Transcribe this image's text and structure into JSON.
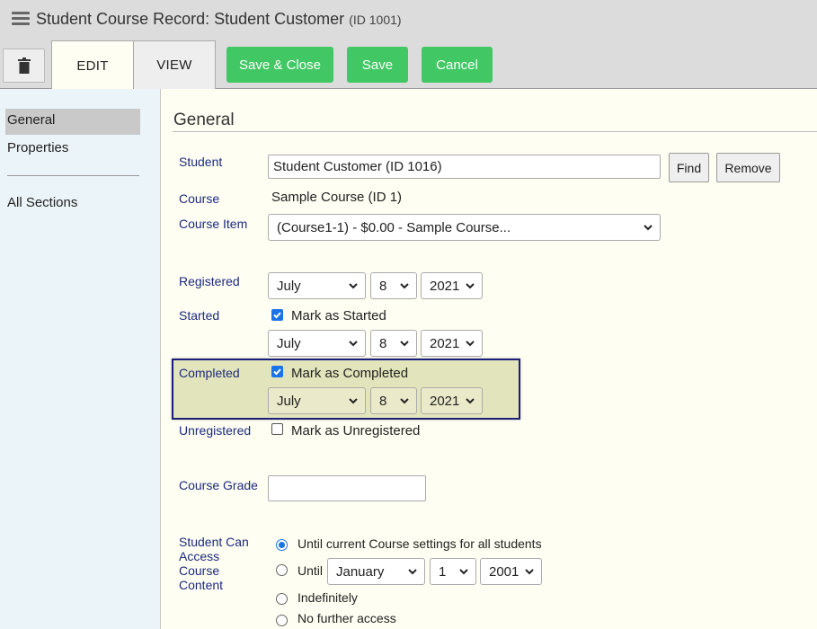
{
  "window": {
    "title": "Student Course Record: Student Customer",
    "title_id": "(ID 1001)"
  },
  "toolbar": {
    "tabs": [
      {
        "label": "EDIT"
      },
      {
        "label": "VIEW"
      }
    ],
    "save_close": "Save & Close",
    "save": "Save",
    "cancel": "Cancel"
  },
  "sidebar": {
    "items": [
      {
        "label": "General"
      },
      {
        "label": "Properties"
      },
      {
        "label": "All Sections"
      }
    ]
  },
  "section": {
    "title": "General"
  },
  "form": {
    "student": {
      "label": "Student",
      "value": "Student Customer (ID 1016)",
      "find": "Find",
      "remove": "Remove"
    },
    "course": {
      "label": "Course",
      "value": "Sample Course (ID 1)"
    },
    "course_item": {
      "label": "Course Item",
      "value": "(Course1-1) - $0.00 - Sample Course..."
    },
    "registered": {
      "label": "Registered",
      "month": "July",
      "day": "8",
      "year": "2021"
    },
    "started": {
      "label": "Started",
      "checkbox_label": "Mark as Started",
      "checked": true,
      "month": "July",
      "day": "8",
      "year": "2021"
    },
    "completed": {
      "label": "Completed",
      "checkbox_label": "Mark as Completed",
      "checked": true,
      "month": "July",
      "day": "8",
      "year": "2021"
    },
    "unregistered": {
      "label": "Unregistered",
      "checkbox_label": "Mark as Unregistered",
      "checked": false
    },
    "grade": {
      "label": "Course Grade",
      "value": ""
    },
    "access": {
      "label_lines": [
        "Student Can",
        "Access",
        "Course",
        "Content"
      ],
      "options": [
        {
          "label": "Until current Course settings for all students",
          "selected": true
        },
        {
          "label": "Until",
          "selected": false,
          "month": "January",
          "day": "1",
          "year": "2001"
        },
        {
          "label": "Indefinitely",
          "selected": false
        },
        {
          "label": "No further access",
          "selected": false
        }
      ]
    }
  },
  "colors": {
    "accent_green": "#41c864",
    "label_blue": "#1c2a80",
    "highlight_border": "#1c1f7a"
  }
}
